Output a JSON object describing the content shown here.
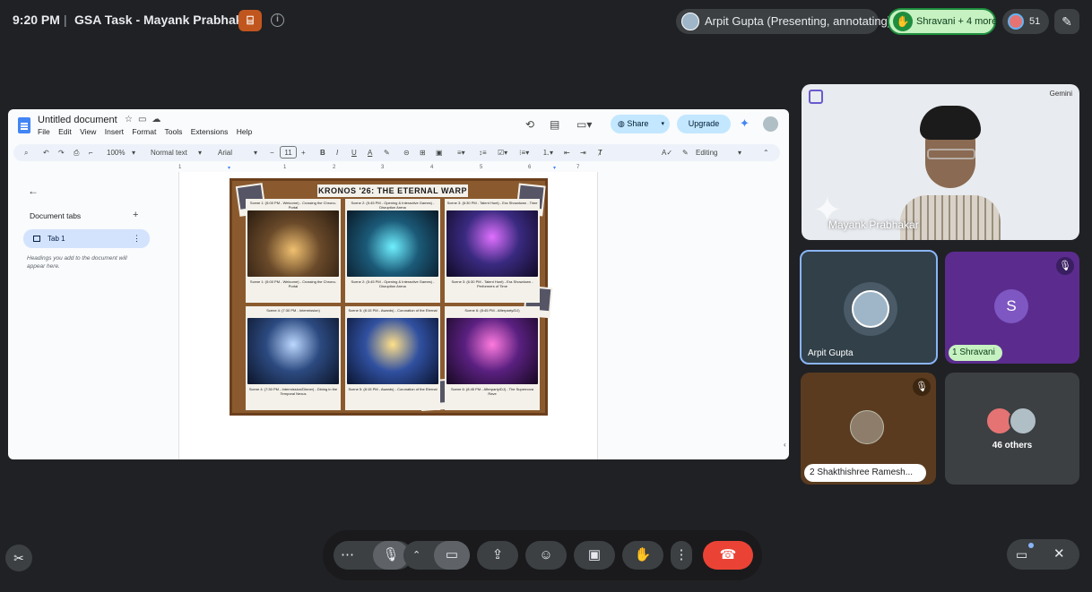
{
  "topbar": {
    "time": "9:20 PM",
    "separator": "|",
    "meeting_title": "GSA Task - Mayank Prabhakar",
    "presenter_chip": "Arpit Gupta (Presenting, annotating)",
    "raised_hands": "Shravani + 4 more",
    "participant_count": "51"
  },
  "doc": {
    "title": "Untitled document",
    "menu": [
      "File",
      "Edit",
      "View",
      "Insert",
      "Format",
      "Tools",
      "Extensions",
      "Help"
    ],
    "share_label": "Share",
    "upgrade_label": "Upgrade",
    "toolbar": {
      "zoom": "100%",
      "style": "Normal text",
      "font": "Arial",
      "font_size": "11",
      "mode": "Editing"
    },
    "ruler": [
      "1",
      "1",
      "2",
      "3",
      "4",
      "5",
      "6",
      "7"
    ],
    "sidebar": {
      "heading": "Document tabs",
      "tab_label": "Tab 1",
      "hint": "Headings you add to the document will appear here."
    },
    "poster": {
      "title": "KRONOS '26: THE ETERNAL WARP",
      "panels": [
        {
          "top": "Scene 1: (5:00 PM - Welcome) - Crossing the Chrono-Portal",
          "bottom": "Scene 1: (5:00 PM - Welcome) - Crossing the Chrono-Portal",
          "color": "#3a2c1c"
        },
        {
          "top": "Scene 2: (5:45 PM - Opening & Interactive Games) - Disruption Arena",
          "bottom": "Scene 2: (5:45 PM - Opening & Interactive Games) - Disruption Arena",
          "color": "#16384a"
        },
        {
          "top": "Scene 3: (6:30 PM - Talent Hunt) - Era Showdown - Time",
          "bottom": "Scene 3: (6:30 PM - Talent Hunt) - Era Showdown - Performers of Time",
          "color": "#2a2050"
        },
        {
          "top": "Scene 4: (7:30 PM - Intermission)",
          "bottom": "Scene 4: (7:30 PM - Intermission/Dinner) - Dining in the Temporal Nexus",
          "color": "#1e2c48"
        },
        {
          "top": "Scene 5: (8:15 PM - Awards) - Coronation of the Eternal",
          "bottom": "Scene 5: (8:15 PM - Awards) - Coronation of the Eternal",
          "color": "#1a2a52"
        },
        {
          "top": "Scene 6: (8:45 PM - Afterparty/DJ)",
          "bottom": "Scene 6: (8:45 PM - Afterparty/DJ) - The Supernova Rave",
          "color": "#38184e"
        }
      ]
    }
  },
  "participants": {
    "mayank_name": "Mayank Prabhakar",
    "gemini_label": "Gemini",
    "arpit_name": "Arpit Gupta",
    "shravani_initial": "S",
    "shravani_badge": "1 Shravani",
    "shakthi_badge": "2 Shakthishree Ramesh...",
    "others_label": "46 others"
  },
  "colors": {
    "background": "#202124",
    "accent_blue": "#8ab4f8",
    "raise_hand_green": "#c6f1c1",
    "end_call_red": "#ea4335"
  }
}
